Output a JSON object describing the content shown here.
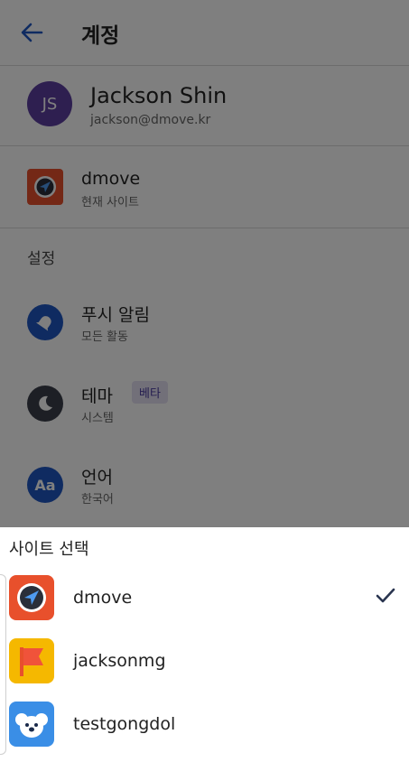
{
  "header": {
    "title": "계정"
  },
  "account": {
    "initials": "JS",
    "name": "Jackson Shin",
    "email": "jackson@dmove.kr"
  },
  "current_site": {
    "name": "dmove",
    "subtitle": "현재 사이트"
  },
  "settings": {
    "section_label": "설정",
    "push": {
      "label": "푸시 알림",
      "value": "모든 활동",
      "icon": "bell-icon",
      "color": "#1f57c3"
    },
    "theme": {
      "label": "테마",
      "badge": "베타",
      "value": "시스템",
      "icon": "moon-icon",
      "color": "#3a3f4a"
    },
    "language": {
      "label": "언어",
      "value": "한국어",
      "icon_text": "Aa",
      "color": "#1f57c3"
    }
  },
  "site_picker": {
    "title": "사이트 선택",
    "options": [
      {
        "label": "dmove",
        "selected": true,
        "icon": "compass-icon",
        "color": "#e8502c"
      },
      {
        "label": "jacksonmg",
        "selected": false,
        "icon": "flag-icon",
        "color": "#f5b800"
      },
      {
        "label": "testgongdol",
        "selected": false,
        "icon": "koala-icon",
        "color": "#3a8ee6"
      }
    ]
  }
}
